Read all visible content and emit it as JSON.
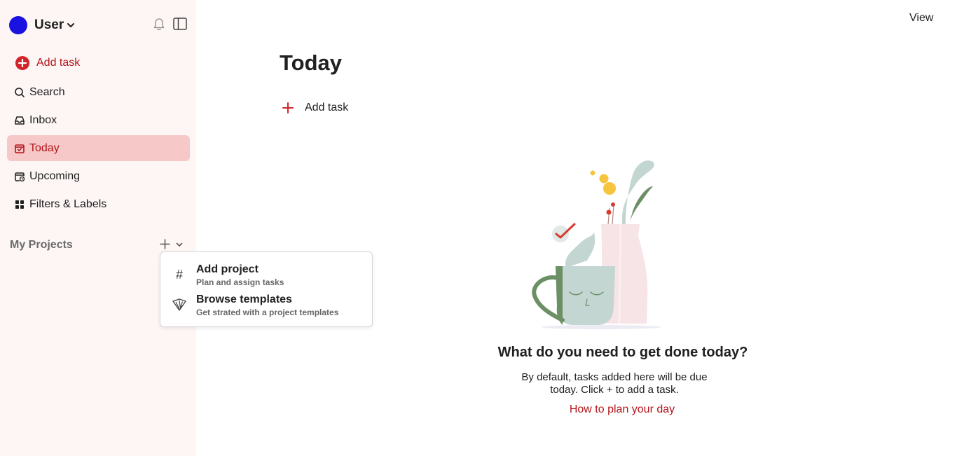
{
  "user": {
    "name": "User",
    "avatar_color": "#1a12e0"
  },
  "sidebar": {
    "add_task": "Add task",
    "items": [
      {
        "label": "Search",
        "icon": "search-icon"
      },
      {
        "label": "Inbox",
        "icon": "inbox-icon"
      },
      {
        "label": "Today",
        "icon": "calendar-today-icon",
        "active": true
      },
      {
        "label": "Upcoming",
        "icon": "calendar-upcoming-icon"
      },
      {
        "label": "Filters & Labels",
        "icon": "grid-icon"
      }
    ],
    "projects_label": "My Projects"
  },
  "menu": {
    "items": [
      {
        "title": "Add project",
        "subtitle": "Plan and assign tasks",
        "icon": "hash-icon"
      },
      {
        "title": "Browse templates",
        "subtitle": "Get strated with a project templates",
        "icon": "templates-icon"
      }
    ]
  },
  "main": {
    "view_label": "View",
    "title": "Today",
    "add_task": "Add task",
    "empty_title": "What do you need to get done today?",
    "empty_desc": "By default, tasks added here will be due today. Click + to add a task.",
    "empty_link": "How to plan your day"
  },
  "colors": {
    "accent": "#b5151b",
    "active_bg": "#f6c8c8",
    "sidebar_bg": "#fdf6f5"
  }
}
